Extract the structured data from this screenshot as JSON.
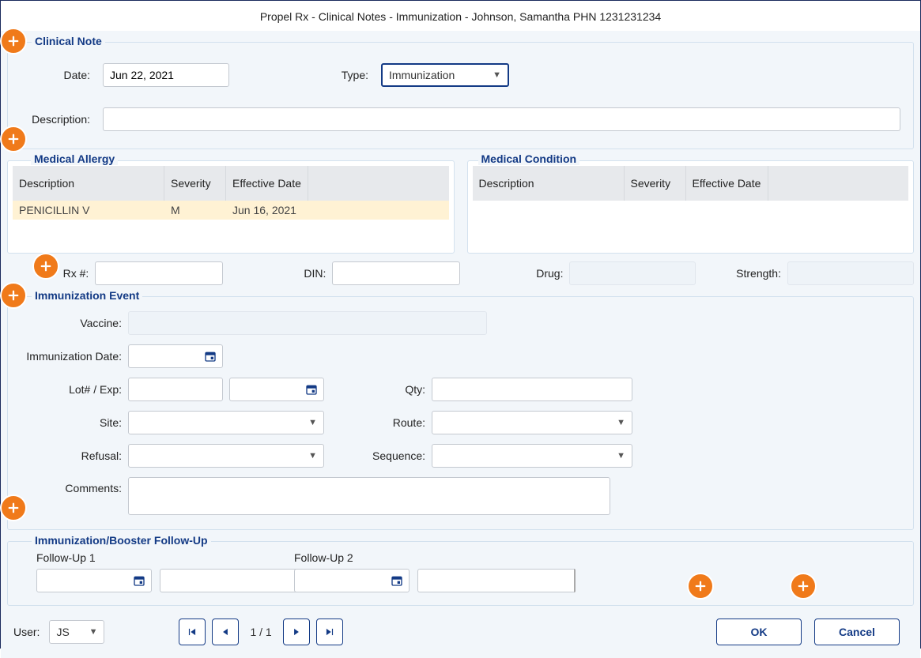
{
  "window_title": "Propel Rx - Clinical Notes - Immunization - Johnson, Samantha  PHN 1231231234",
  "clinical_note": {
    "section_label": "Clinical Note",
    "date_label": "Date:",
    "date_value": "Jun 22, 2021",
    "type_label": "Type:",
    "type_value": "Immunization",
    "description_label": "Description:",
    "description_value": ""
  },
  "allergy": {
    "section_label": "Medical Allergy",
    "columns": [
      "Description",
      "Severity",
      "Effective Date"
    ],
    "rows": [
      {
        "description": "PENICILLIN V",
        "severity": "M",
        "effective_date": "Jun 16, 2021"
      }
    ]
  },
  "condition": {
    "section_label": "Medical Condition",
    "columns": [
      "Description",
      "Severity",
      "Effective Date"
    ]
  },
  "mid": {
    "rx_label": "Rx #:",
    "rx_value": "",
    "din_label": "DIN:",
    "din_value": "",
    "drug_label": "Drug:",
    "drug_value": "",
    "strength_label": "Strength:",
    "strength_value": ""
  },
  "event": {
    "section_label": "Immunization Event",
    "vaccine_label": "Vaccine:",
    "vaccine_value": "",
    "imm_date_label": "Immunization Date:",
    "imm_date_value": "",
    "lot_label": "Lot# / Exp:",
    "lot_value": "",
    "exp_value": "",
    "qty_label": "Qty:",
    "qty_value": "",
    "site_label": "Site:",
    "site_value": "",
    "route_label": "Route:",
    "route_value": "",
    "refusal_label": "Refusal:",
    "refusal_value": "",
    "sequence_label": "Sequence:",
    "sequence_value": "",
    "comments_label": "Comments:",
    "comments_value": ""
  },
  "followup": {
    "section_label": "Immunization/Booster Follow-Up",
    "f1_label": "Follow-Up 1",
    "f1_date": "",
    "f1_num": "",
    "f2_label": "Follow-Up 2",
    "f2_date": "",
    "f2_num": ""
  },
  "footer": {
    "user_label": "User:",
    "user_value": "JS",
    "pager": "1 / 1",
    "ok_label": "OK",
    "cancel_label": "Cancel"
  }
}
